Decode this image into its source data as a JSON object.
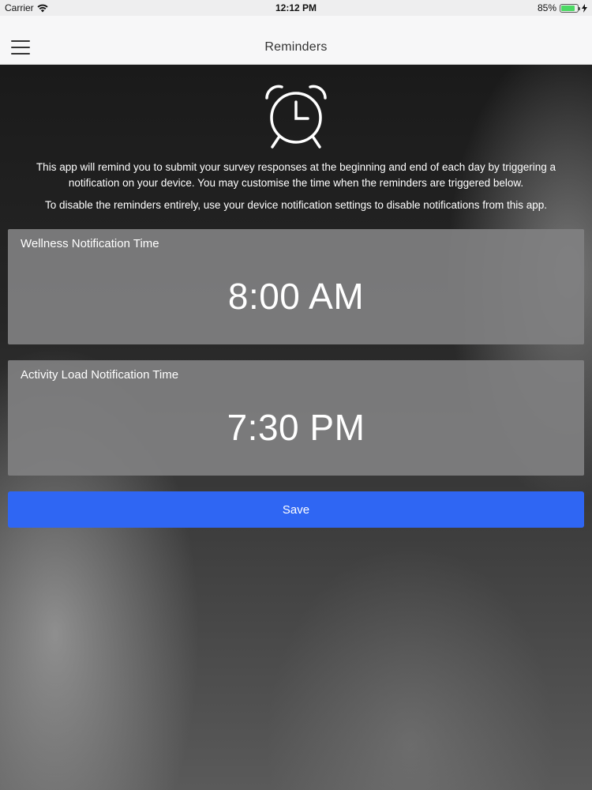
{
  "status_bar": {
    "carrier": "Carrier",
    "time": "12:12 PM",
    "battery_percent": "85%",
    "battery_level": 0.85,
    "icons": [
      "wifi-icon",
      "battery-icon",
      "charging-icon"
    ]
  },
  "nav": {
    "title": "Reminders",
    "menu_icon": "hamburger-menu-icon"
  },
  "hero": {
    "icon": "alarm-clock-icon",
    "intro_text": "This app will remind you to submit your survey responses at the beginning and end of each day by triggering a notification on your device. You may customise the time when the reminders are triggered below.",
    "disable_text": "To disable the reminders entirely, use your device notification settings to disable notifications from this app."
  },
  "reminders": [
    {
      "label": "Wellness Notification Time",
      "time": "8:00 AM"
    },
    {
      "label": "Activity Load Notification Time",
      "time": "7:30 PM"
    }
  ],
  "save_label": "Save",
  "colors": {
    "accent": "#2f66f3",
    "battery": "#4cd964",
    "card": "#808081"
  }
}
